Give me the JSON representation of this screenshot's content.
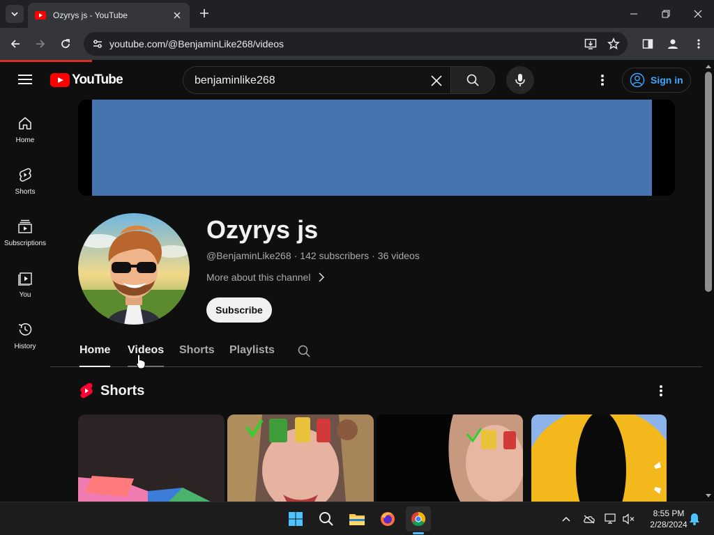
{
  "browser": {
    "tab_title": "Ozyrys js - YouTube",
    "url": "youtube.com/@BenjaminLike268/videos"
  },
  "youtube": {
    "logo_text": "YouTube",
    "search_value": "benjaminlike268",
    "signin_label": "Sign in",
    "guide": [
      {
        "label": "Home",
        "icon": "home-icon"
      },
      {
        "label": "Shorts",
        "icon": "shorts-icon"
      },
      {
        "label": "Subscriptions",
        "icon": "subscriptions-icon"
      },
      {
        "label": "You",
        "icon": "you-icon"
      },
      {
        "label": "History",
        "icon": "history-icon"
      }
    ],
    "channel": {
      "name": "Ozyrys js",
      "handle": "@BenjaminLike268",
      "subscribers": "142 subscribers",
      "videos": "36 videos",
      "separator": "·",
      "more_about": "More about this channel",
      "subscribe_label": "Subscribe"
    },
    "tabs": [
      "Home",
      "Videos",
      "Shorts",
      "Playlists"
    ],
    "active_tab": "Home",
    "shorts_section_title": "Shorts",
    "colors": {
      "banner": "#4574b0",
      "brand_red": "#ff0000",
      "link_blue": "#3ea6ff"
    }
  },
  "taskbar": {
    "time": "8:55 PM",
    "date": "2/28/2024"
  }
}
